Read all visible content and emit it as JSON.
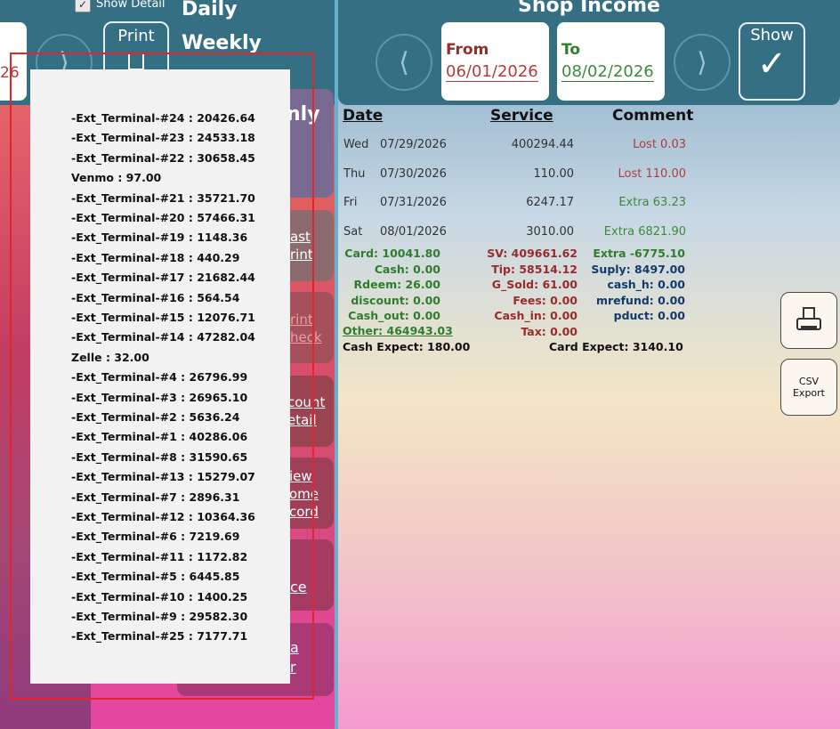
{
  "left_panel": {
    "show_detail_label": "Show Detail",
    "date_partial": "26",
    "nav_next": "⟩",
    "print_label": "Print",
    "menu": [
      "Daily",
      "Weekly",
      "nly"
    ],
    "side_buttons": [
      {
        "line1": "ast",
        "line2": "rint"
      },
      {
        "line1": "rint",
        "line2": "heck"
      },
      {
        "line1": "count",
        "line2": "etail"
      },
      {
        "line1": "iew",
        "line2": "ome",
        "line3": "cord"
      },
      {
        "line1": "ce",
        "line2": ""
      },
      {
        "line1": "a",
        "line2": "r"
      }
    ]
  },
  "shop_income": {
    "title": "Shop Income",
    "prev": "⟨",
    "next": "⟩",
    "from_label": "From",
    "from_value": "06/01/2026",
    "to_label": "To",
    "to_value": "08/02/2026",
    "show_label": "Show",
    "show_check": "✓",
    "headers": {
      "date": "Date",
      "service": "Service",
      "comment": "Comment"
    },
    "rows": [
      {
        "day": "Wed",
        "date": "07/29/2026",
        "service": "400294.44",
        "comment": "Lost 0.03",
        "kind": "lost"
      },
      {
        "day": "Thu",
        "date": "07/30/2026",
        "service": "110.00",
        "comment": "Lost 110.00",
        "kind": "lost"
      },
      {
        "day": "Fri",
        "date": "07/31/2026",
        "service": "6247.17",
        "comment": "Extra 63.23",
        "kind": "extra"
      },
      {
        "day": "Sat",
        "date": "08/01/2026",
        "service": "3010.00",
        "comment": "Extra 6821.90",
        "kind": "extra"
      }
    ],
    "summary": {
      "col1": [
        "Card: 10041.80",
        "Cash: 0.00",
        "Rdeem: 26.00",
        "discount: 0.00",
        "Cash_out: 0.00"
      ],
      "other": "Other: 464943.03",
      "cash_expect": "Cash Expect: 180.00",
      "col2": [
        "SV: 409661.62",
        "Tip: 58514.12",
        "G_Sold: 61.00",
        "Fees: 0.00",
        "Cash_in: 0.00",
        "Tax: 0.00"
      ],
      "col3": [
        "Extra -6775.10",
        "Suply: 8497.00",
        "cash_h: 0.00",
        "mrefund: 0.00",
        "pduct: 0.00"
      ],
      "card_expect": "Card Expect: 3140.10"
    },
    "csv_label_1": "CSV",
    "csv_label_2": "Export"
  },
  "popup": {
    "lines": [
      "-Ext_Terminal-#24 : 20426.64",
      "-Ext_Terminal-#23 : 24533.18",
      "-Ext_Terminal-#22 : 30658.45",
      "Venmo : 97.00",
      "-Ext_Terminal-#21 : 35721.70",
      "-Ext_Terminal-#20 : 57466.31",
      "-Ext_Terminal-#19 : 1148.36",
      "-Ext_Terminal-#18 : 440.29",
      "-Ext_Terminal-#17 : 21682.44",
      "-Ext_Terminal-#16 : 564.54",
      "-Ext_Terminal-#15 : 12076.71",
      "-Ext_Terminal-#14 : 47282.04",
      "Zelle : 32.00",
      "-Ext_Terminal-#4 : 26796.99",
      "-Ext_Terminal-#3 : 26965.10",
      "-Ext_Terminal-#2 : 5636.24",
      "-Ext_Terminal-#1 : 40286.06",
      "-Ext_Terminal-#8 : 31590.65",
      "-Ext_Terminal-#13 : 15279.07",
      "-Ext_Terminal-#7 : 2896.31",
      "-Ext_Terminal-#12 : 10364.36",
      "-Ext_Terminal-#6 : 7219.69",
      "-Ext_Terminal-#11 : 1172.82",
      "-Ext_Terminal-#5 : 6445.85",
      "-Ext_Terminal-#10 : 1400.25",
      "-Ext_Terminal-#9 : 29582.30",
      "-Ext_Terminal-#25 : 7177.71"
    ]
  }
}
